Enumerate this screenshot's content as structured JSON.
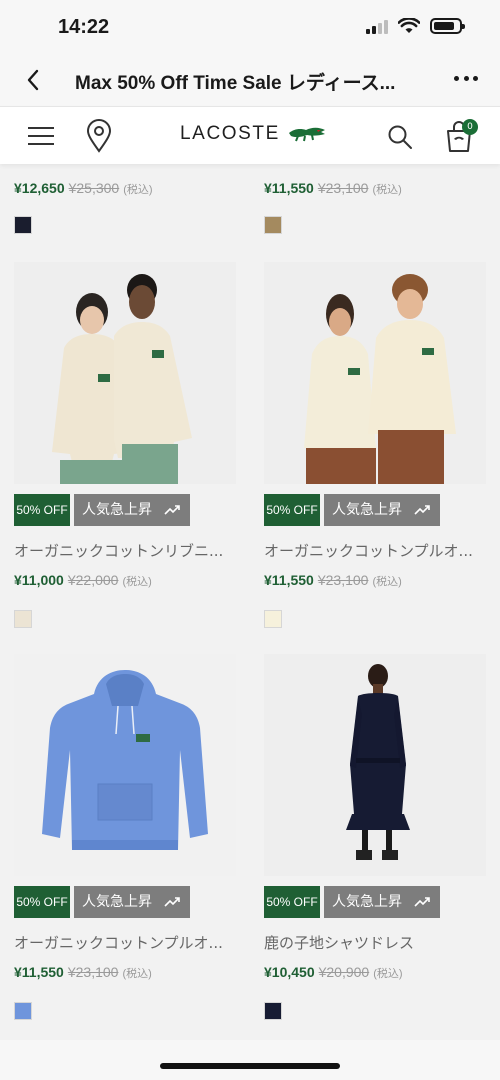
{
  "status_bar": {
    "time": "14:22"
  },
  "browser": {
    "title": "Max 50% Off Time Sale レディース..."
  },
  "header": {
    "logo_text": "LACOSTE",
    "cart_count": "0"
  },
  "previous_row": [
    {
      "price": "¥12,650",
      "original_price": "¥25,300",
      "tax": "(税込)",
      "swatch_color": "#1a1d2e"
    },
    {
      "price": "¥11,550",
      "original_price": "¥23,100",
      "tax": "(税込)",
      "swatch_color": "#a48a5f"
    }
  ],
  "products": [
    {
      "discount": "50% OFF",
      "trend": "人気急上昇",
      "name": "オーガニックコットンリブニ...",
      "price": "¥11,000",
      "original_price": "¥22,000",
      "tax": "(税込)",
      "swatch_color": "#ece4d4",
      "image": "models-cream-sweaters-icon"
    },
    {
      "discount": "50% OFF",
      "trend": "人気急上昇",
      "name": "オーガニックコットンプルオ...",
      "price": "¥11,550",
      "original_price": "¥23,100",
      "tax": "(税込)",
      "swatch_color": "#f6f1dc",
      "image": "models-cream-hoodies-icon"
    },
    {
      "discount": "50% OFF",
      "trend": "人気急上昇",
      "name": "オーガニックコットンプルオ...",
      "price": "¥11,550",
      "original_price": "¥23,100",
      "tax": "(税込)",
      "swatch_color": "#6f95dc",
      "image": "blue-hoodie-icon"
    },
    {
      "discount": "50% OFF",
      "trend": "人気急上昇",
      "name": "鹿の子地シャツドレス",
      "price": "¥10,450",
      "original_price": "¥20,900",
      "tax": "(税込)",
      "swatch_color": "#171c33",
      "image": "navy-shirt-dress-icon"
    }
  ]
}
